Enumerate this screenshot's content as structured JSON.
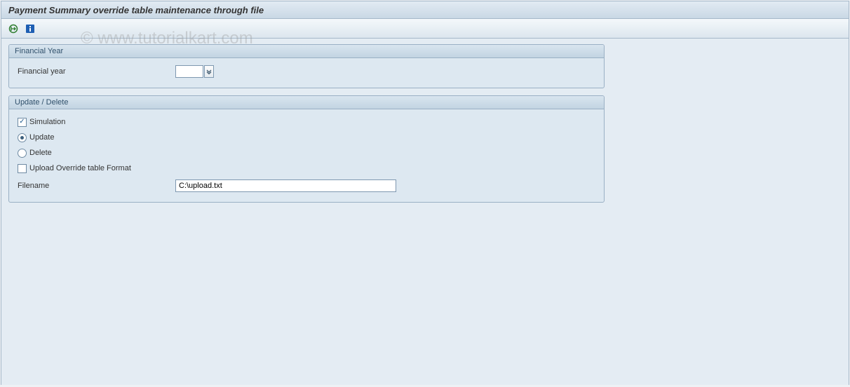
{
  "title": "Payment Summary override table maintenance through file",
  "toolbar": {
    "execute": "execute",
    "info": "info"
  },
  "group_financial": {
    "title": "Financial Year",
    "field_label": "Financial year",
    "value": ""
  },
  "group_update": {
    "title": "Update / Delete",
    "simulation": {
      "label": "Simulation",
      "checked": true
    },
    "update": {
      "label": "Update",
      "selected": true
    },
    "delete": {
      "label": "Delete",
      "selected": false
    },
    "upload_fmt": {
      "label": "Upload Override table Format",
      "checked": false
    },
    "filename_label": "Filename",
    "filename_value": "C:\\upload.txt"
  },
  "watermark": "© www.tutorialkart.com"
}
